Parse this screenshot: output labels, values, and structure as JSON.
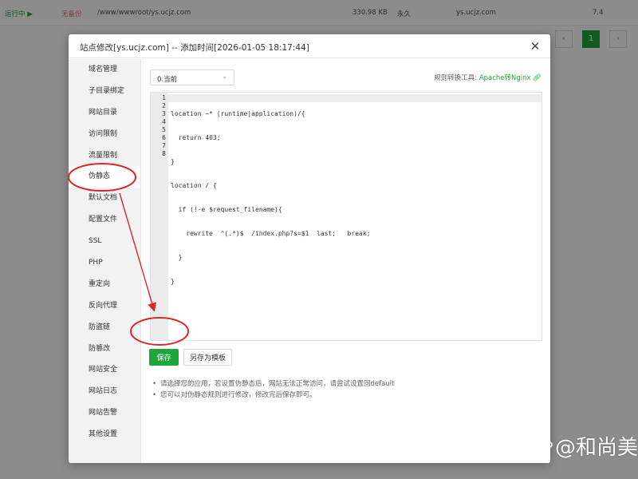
{
  "background": {
    "row": {
      "status": "运行中 ▶",
      "backup": "无备份",
      "path": "/www/wwwroot/ys.ucjz.com",
      "size": "330.98 KB",
      "expire": "永久",
      "domain": "ys.ucjz.com",
      "php": "7.4"
    },
    "pager": {
      "prev": "‹",
      "current": "1",
      "next": "›"
    }
  },
  "modal": {
    "title": "站点修改[ys.ucjz.com] -- 添加时间[2026-01-05 18:17:44]",
    "close_label": "✕"
  },
  "sidebar": {
    "items": [
      {
        "label": "域名管理"
      },
      {
        "label": "子目录绑定"
      },
      {
        "label": "网站目录"
      },
      {
        "label": "访问限制"
      },
      {
        "label": "流量限制"
      },
      {
        "label": "伪静态"
      },
      {
        "label": "默认文档"
      },
      {
        "label": "配置文件"
      },
      {
        "label": "SSL"
      },
      {
        "label": "PHP"
      },
      {
        "label": "重定向"
      },
      {
        "label": "反向代理"
      },
      {
        "label": "防盗链"
      },
      {
        "label": "防篡改"
      },
      {
        "label": "网站安全"
      },
      {
        "label": "网站日志"
      },
      {
        "label": "网站告警"
      },
      {
        "label": "其他设置"
      }
    ],
    "active_index": 5
  },
  "rewrite": {
    "select_value": "0.当前",
    "rule_tool_label": "规则转换工具:",
    "rule_tool_link": "Apache转Nginx",
    "line_numbers": [
      "1",
      "2",
      "3",
      "4",
      "5",
      "6",
      "7",
      "8"
    ],
    "code_lines": [
      "location ~* (runtime|application)/{",
      "  return 403;",
      "}",
      "location / {",
      "  if (!-e $request_filename){",
      "    rewrite  ^(.*)$  /index.php?s=$1  last;   break;",
      "  }",
      "}"
    ],
    "save_label": "保存",
    "save_template_label": "另存为模板",
    "tips": [
      "请选择您的应用，若设置伪静态后，网站无法正常访问，请尝试设置回default",
      "您可以对伪静态规则进行修改，修改完后保存即可。"
    ]
  },
  "watermark": {
    "text": "@和尚美"
  },
  "colors": {
    "accent": "#20a53a",
    "annotation": "#d9262c",
    "overlay": "rgba(0,0,0,0.45)"
  },
  "icons": {
    "close": "close-icon",
    "dropdown": "chevron-down-icon",
    "link": "link-icon",
    "logo": "baidu-paw-icon"
  }
}
